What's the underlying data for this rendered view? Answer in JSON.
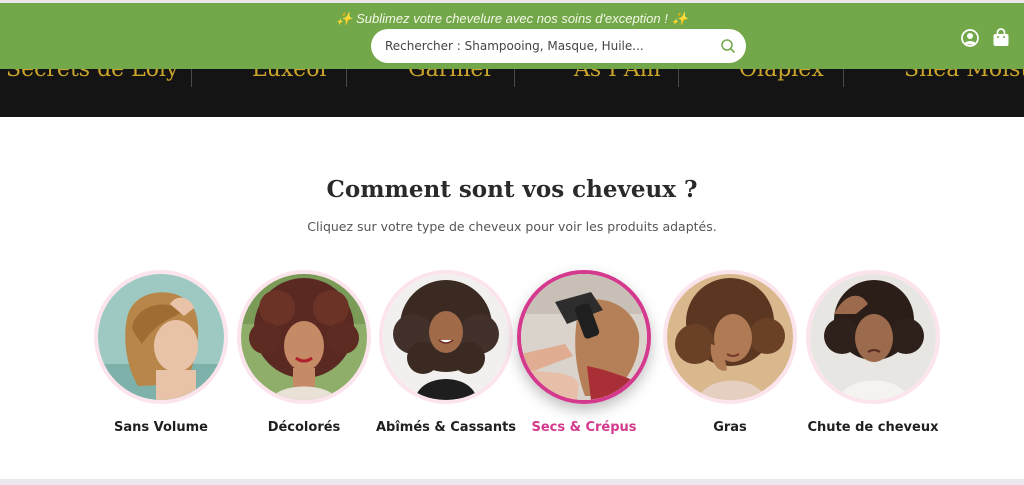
{
  "header": {
    "promo_text": "✨ Sublimez votre chevelure avec nos soins d'exception ! ✨",
    "search_placeholder": "Rechercher : Shampooing, Masque, Huile...",
    "accent_color": "#73a84a"
  },
  "brands": [
    "Secrets de Loly",
    "Luxéol",
    "Garnier",
    "As I Am",
    "Olaplex",
    "Shea Moisture"
  ],
  "section": {
    "title": "Comment sont vos cheveux ?",
    "subtitle": "Cliquez sur votre type de cheveux pour voir les produits adaptés."
  },
  "categories": [
    {
      "label": "Sans Volume",
      "active": false
    },
    {
      "label": "Décolorés",
      "active": false
    },
    {
      "label": "Abîmés & Cassants",
      "active": false
    },
    {
      "label": "Secs & Crépus",
      "active": true
    },
    {
      "label": "Gras",
      "active": false
    },
    {
      "label": "Chute de cheveux",
      "active": false
    }
  ],
  "colors": {
    "active_label": "#d4398d",
    "brand_text": "#c9a52a",
    "brand_bar": "#141414"
  },
  "icons": [
    "search-icon",
    "account-icon",
    "cart-icon"
  ]
}
